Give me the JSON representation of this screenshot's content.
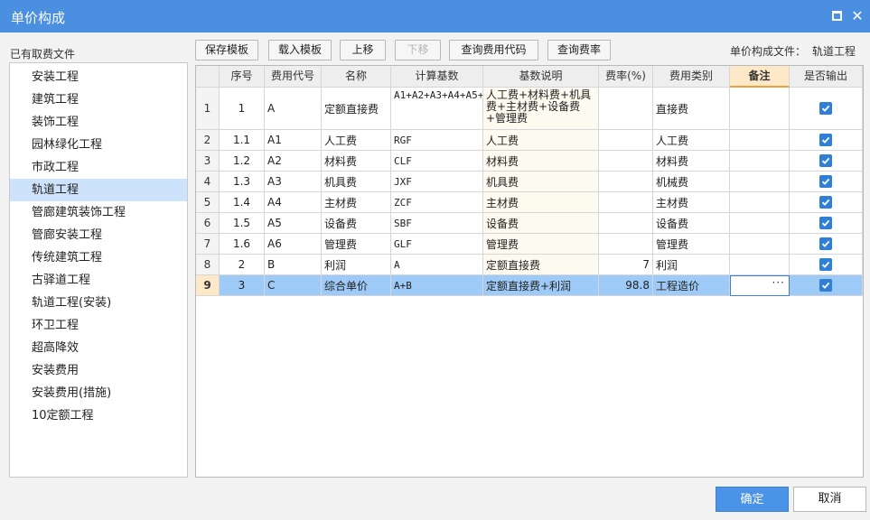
{
  "window": {
    "title": "单价构成"
  },
  "left_panel": {
    "label": "已有取费文件",
    "items": [
      "安装工程",
      "建筑工程",
      "装饰工程",
      "园林绿化工程",
      "市政工程",
      "轨道工程",
      "管廊建筑装饰工程",
      "管廊安装工程",
      "传统建筑工程",
      "古驿道工程",
      "轨道工程(安装)",
      "环卫工程",
      "超高降效",
      "安装费用",
      "安装费用(措施)",
      "10定额工程"
    ],
    "selected_index": 5
  },
  "toolbar": {
    "save_template": "保存模板",
    "load_template": "载入模板",
    "move_up": "上移",
    "move_down": "下移",
    "query_code": "查询费用代码",
    "query_rate": "查询费率",
    "file_label": "单价构成文件：",
    "file_value": "轨道工程"
  },
  "table": {
    "headers": [
      "序号",
      "费用代号",
      "名称",
      "计算基数",
      "基数说明",
      "费率(%)",
      "费用类别",
      "备注",
      "是否输出"
    ],
    "active_header_index": 7,
    "rows": [
      {
        "rownum": "1",
        "seq": "1",
        "code": "A",
        "name": "定额直接费",
        "base": "A1+A2+A3+A4+A5+A6",
        "desc": "人工费+材料费+机具费+主材费+设备费+管理费",
        "rate": "",
        "category": "直接费",
        "note": "",
        "output": true
      },
      {
        "rownum": "2",
        "seq": "1.1",
        "code": "A1",
        "name": "人工费",
        "base": "RGF",
        "desc": "人工费",
        "rate": "",
        "category": "人工费",
        "note": "",
        "output": true
      },
      {
        "rownum": "3",
        "seq": "1.2",
        "code": "A2",
        "name": "材料费",
        "base": "CLF",
        "desc": "材料费",
        "rate": "",
        "category": "材料费",
        "note": "",
        "output": true
      },
      {
        "rownum": "4",
        "seq": "1.3",
        "code": "A3",
        "name": "机具费",
        "base": "JXF",
        "desc": "机具费",
        "rate": "",
        "category": "机械费",
        "note": "",
        "output": true
      },
      {
        "rownum": "5",
        "seq": "1.4",
        "code": "A4",
        "name": "主材费",
        "base": "ZCF",
        "desc": "主材费",
        "rate": "",
        "category": "主材费",
        "note": "",
        "output": true
      },
      {
        "rownum": "6",
        "seq": "1.5",
        "code": "A5",
        "name": "设备费",
        "base": "SBF",
        "desc": "设备费",
        "rate": "",
        "category": "设备费",
        "note": "",
        "output": true
      },
      {
        "rownum": "7",
        "seq": "1.6",
        "code": "A6",
        "name": "管理费",
        "base": "GLF",
        "desc": "管理费",
        "rate": "",
        "category": "管理费",
        "note": "",
        "output": true
      },
      {
        "rownum": "8",
        "seq": "2",
        "code": "B",
        "name": "利润",
        "base": "A",
        "desc": "定额直接费",
        "rate": "7",
        "category": "利润",
        "note": "",
        "output": true
      },
      {
        "rownum": "9",
        "seq": "3",
        "code": "C",
        "name": "综合单价",
        "base": "A+B",
        "desc": "定额直接费+利润",
        "rate": "98.8",
        "category": "工程造价",
        "note": "",
        "output": true
      }
    ],
    "selected_row_index": 8,
    "editing_cell_ellipsis": "···"
  },
  "footer": {
    "ok": "确定",
    "cancel": "取消"
  },
  "colors": {
    "titlebar": "#4a8fe0",
    "selection": "#9dcaf6",
    "checkbox": "#2f7fd6",
    "active_header": "#fde8c8"
  }
}
